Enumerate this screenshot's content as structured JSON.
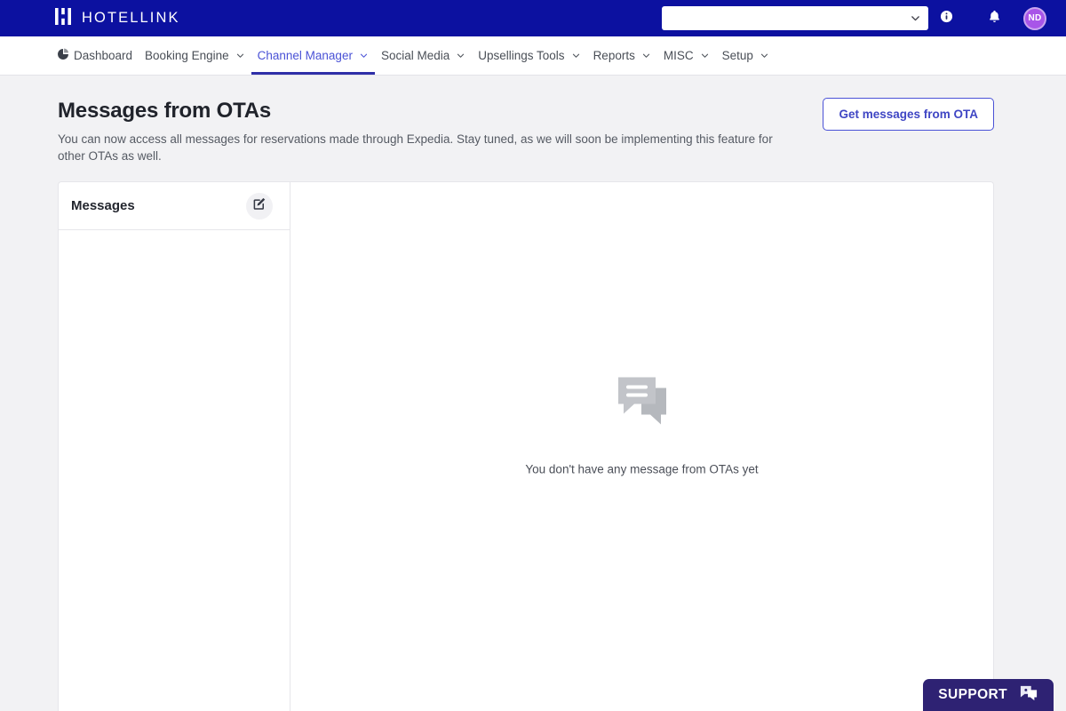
{
  "topbar": {
    "brand_name": "HOTELLINK",
    "brand_icon": "bars-logo-icon",
    "hotel_select": {
      "value": "",
      "placeholder": ""
    },
    "info_icon": "info-circle-icon",
    "bell_icon": "bell-icon",
    "avatar_initials": "ND",
    "bg_color": "#0c11a0",
    "avatar_color": "#a855e8"
  },
  "nav": {
    "items": [
      {
        "label": "Dashboard",
        "icon": "pie-chart-icon",
        "has_caret": false,
        "active": false
      },
      {
        "label": "Booking Engine",
        "icon": "",
        "has_caret": true,
        "active": false
      },
      {
        "label": "Channel Manager",
        "icon": "",
        "has_caret": true,
        "active": true
      },
      {
        "label": "Social Media",
        "icon": "",
        "has_caret": true,
        "active": false
      },
      {
        "label": "Upsellings Tools",
        "icon": "",
        "has_caret": true,
        "active": false
      },
      {
        "label": "Reports",
        "icon": "",
        "has_caret": true,
        "active": false
      },
      {
        "label": "MISC",
        "icon": "",
        "has_caret": true,
        "active": false
      },
      {
        "label": "Setup",
        "icon": "",
        "has_caret": true,
        "active": false
      }
    ],
    "active_color": "#4a52d6"
  },
  "page": {
    "title": "Messages from OTAs",
    "subtitle": "You can now access all messages for reservations made through Expedia. Stay tuned, as we will soon be implementing this feature for other OTAs as well.",
    "get_messages_button": "Get messages from OTA"
  },
  "messages_panel": {
    "title": "Messages",
    "compose_icon": "compose-edit-icon",
    "items": []
  },
  "empty_state": {
    "icon": "chat-bubbles-icon",
    "text": "You don't have any message from OTAs yet"
  },
  "support": {
    "label": "SUPPORT",
    "icon": "support-chat-icon",
    "bg_color": "#2e2273"
  }
}
